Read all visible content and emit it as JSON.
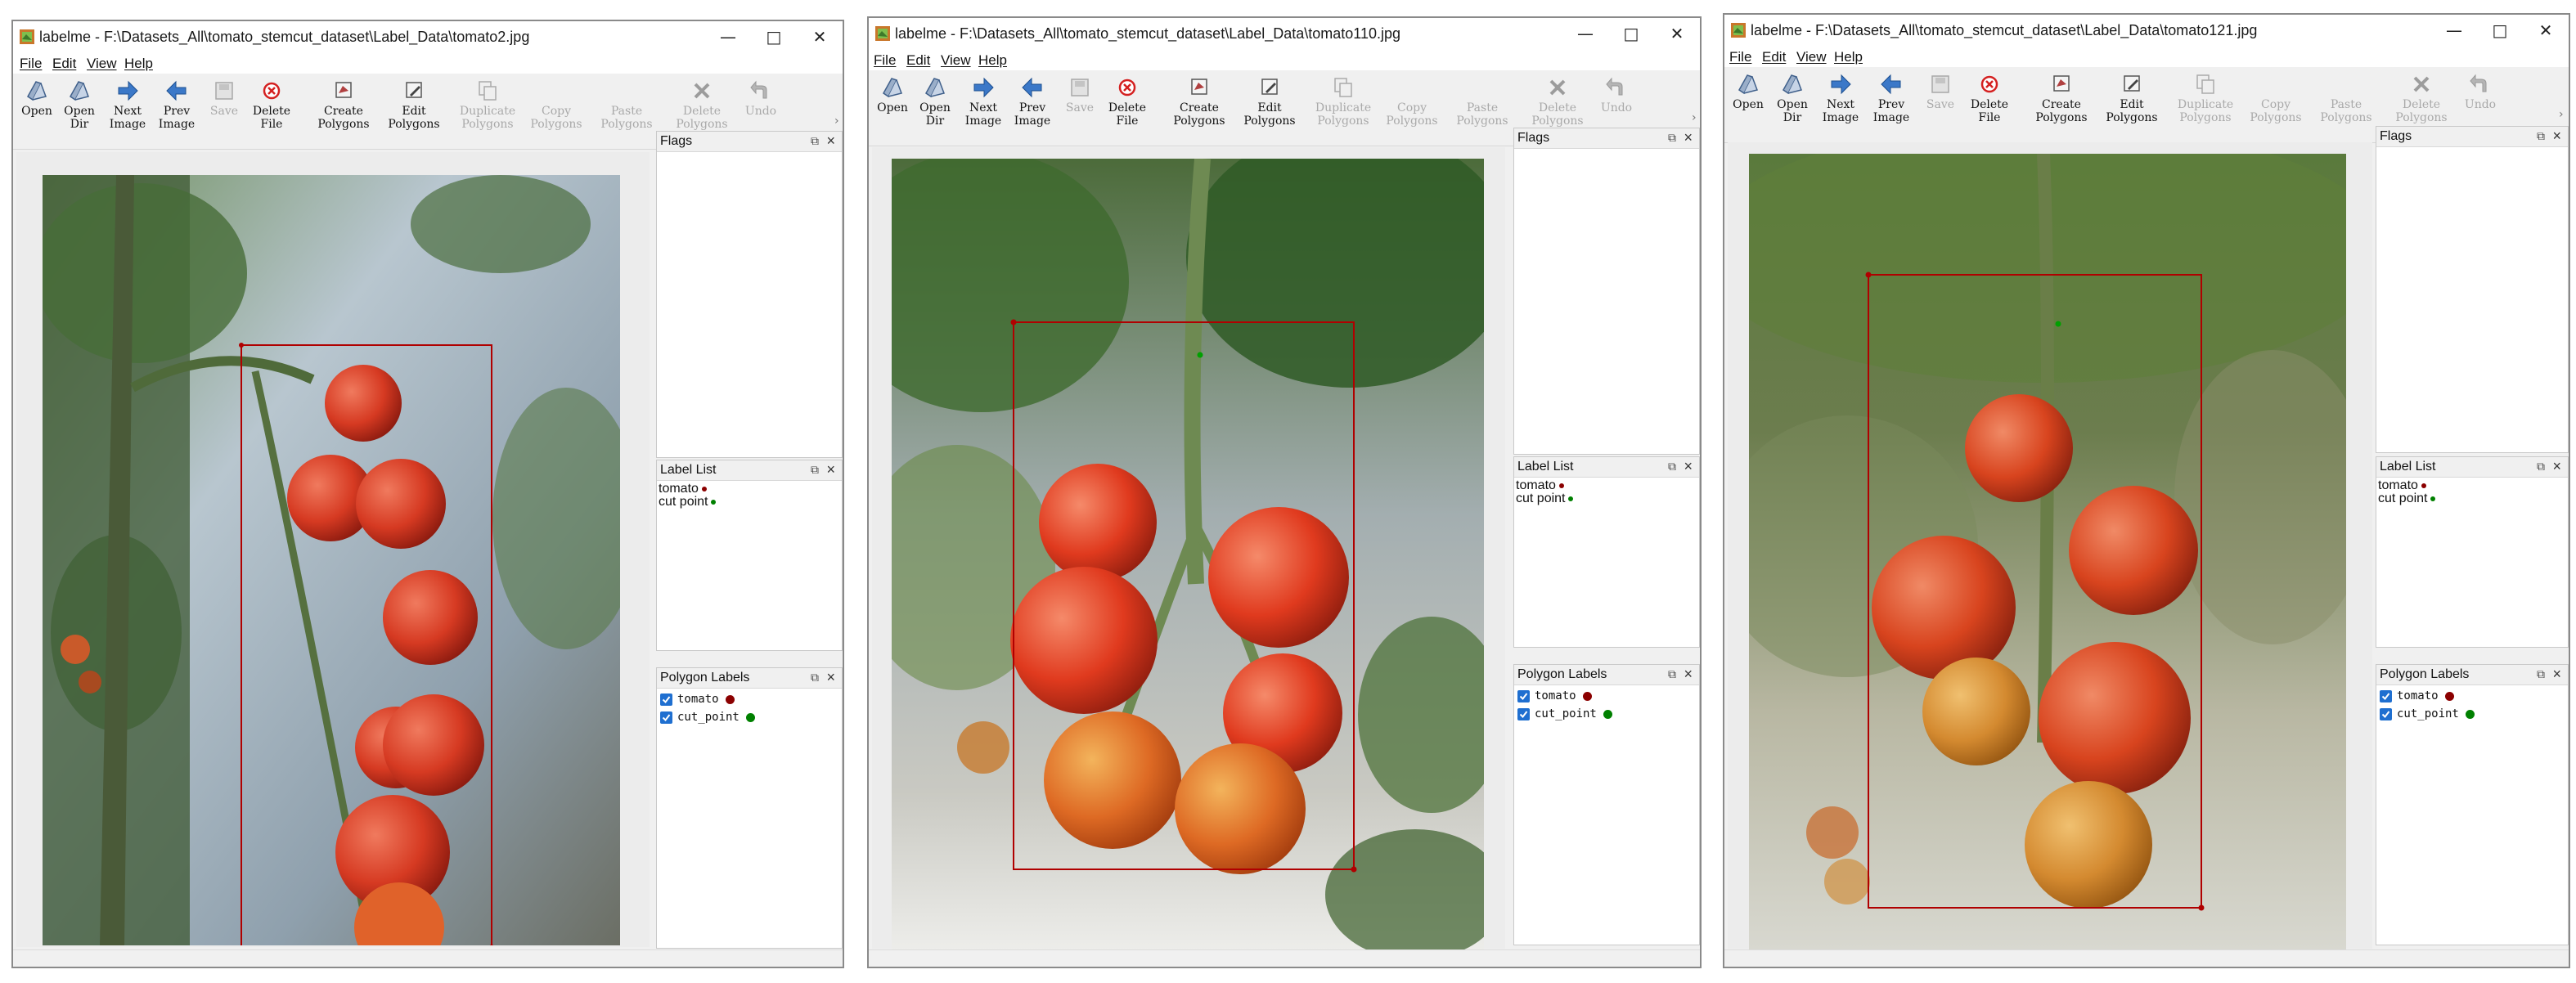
{
  "colors": {
    "tomato_label": "#8b0000",
    "cut_point_label": "#008000",
    "checkbox": "#1f6fd0"
  },
  "menu": {
    "file": "File",
    "edit": "Edit",
    "view": "View",
    "help": "Help"
  },
  "toolbar": {
    "open": "Open",
    "open_dir": "Open\nDir",
    "next_image": "Next\nImage",
    "prev_image": "Prev\nImage",
    "save": "Save",
    "delete_file": "Delete\nFile",
    "create_polygons": "Create\nPolygons",
    "edit_polygons": "Edit\nPolygons",
    "duplicate_polygons": "Duplicate\nPolygons",
    "copy_polygons": "Copy\nPolygons",
    "paste_polygons": "Paste\nPolygons",
    "delete_polygons": "Delete\nPolygons",
    "undo": "Undo"
  },
  "docks": {
    "flags": "Flags",
    "label_list": "Label List",
    "polygon_labels": "Polygon Labels"
  },
  "labels": {
    "tomato": "tomato",
    "cut_point": "cut_point",
    "cut_point_list": "cut point"
  },
  "windows": [
    {
      "title": "labelme - F:\\Datasets_All\\tomato_stemcut_dataset\\Label_Data\\tomato2.jpg"
    },
    {
      "title": "labelme - F:\\Datasets_All\\tomato_stemcut_dataset\\Label_Data\\tomato110.jpg"
    },
    {
      "title": "labelme - F:\\Datasets_All\\tomato_stemcut_dataset\\Label_Data\\tomato121.jpg"
    }
  ]
}
